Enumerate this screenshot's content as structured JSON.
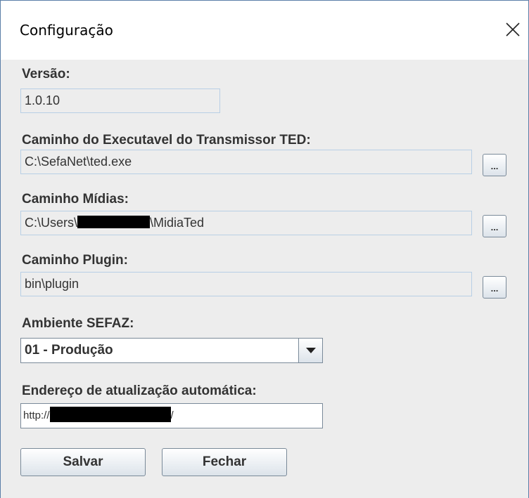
{
  "window": {
    "title": "Configuração",
    "close_glyph": "✕"
  },
  "versao": {
    "label": "Versão:",
    "value": "1.0.10"
  },
  "executavel": {
    "label": "Caminho do Executavel do Transmissor TED:",
    "value": "C:\\SefaNet\\ted.exe",
    "browse_label": "..."
  },
  "midias": {
    "label": "Caminho Mídias:",
    "value_prefix": "C:\\Users\\",
    "value_suffix": "\\MidiaTed",
    "browse_label": "..."
  },
  "plugin": {
    "label": "Caminho Plugin:",
    "value": "bin\\plugin",
    "browse_label": "..."
  },
  "ambiente": {
    "label": "Ambiente SEFAZ:",
    "selected": "01 - Produção"
  },
  "atualizacao": {
    "label": "Endereço de atualização automática:",
    "value_prefix": "http://",
    "value_suffix": "/"
  },
  "actions": {
    "save_label": "Salvar",
    "close_label": "Fechar"
  },
  "icons": {
    "close": "close-icon",
    "dropdown": "chevron-down-icon"
  }
}
